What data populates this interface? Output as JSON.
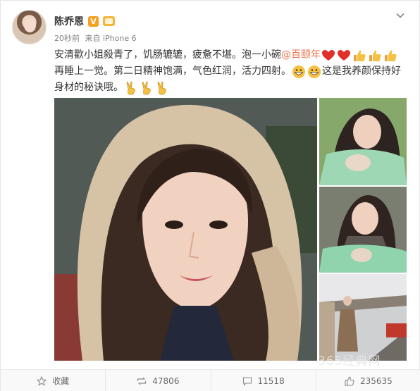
{
  "post": {
    "user_name": "陈乔恩",
    "verified_badge": "V",
    "time": "20秒前",
    "source": "来自 iPhone 6",
    "text_line1_a": "安清歡小姐殺青了，饥肠辘辘，疲惫不堪。泡一小碗",
    "mention": "@百颐年",
    "text_line2_a": "再睡上一觉。第二日精神饱满，气色红润，活力四射。",
    "text_line2_b": "这是我养颜保持好",
    "text_line3": "身材的秘诀哦。"
  },
  "emojis": {
    "line1": [
      "heart-icon",
      "heart-icon",
      "thumbs-up-icon",
      "thumbs-up-icon",
      "thumbs-up-icon"
    ],
    "line2": [
      "grin-icon",
      "grin-icon"
    ],
    "line3": [
      "victory-hand-icon",
      "victory-hand-icon",
      "victory-hand-icon"
    ]
  },
  "watermark": "365经典网",
  "actions": {
    "favorite_label": "收藏",
    "repost_count": "47806",
    "comment_count": "11518",
    "like_count": "235635"
  },
  "colors": {
    "mention": "#eb7350",
    "heart": "#e0302a",
    "emoji_yellow": "#f5c142",
    "verified": "#f3a120"
  }
}
